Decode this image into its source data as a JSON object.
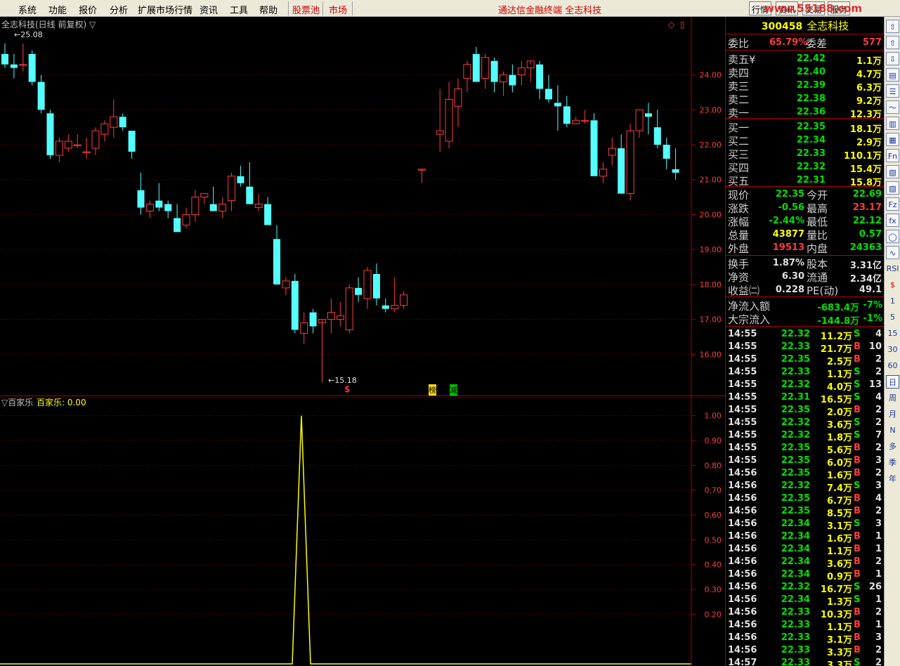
{
  "menubar": {
    "items": [
      "系统",
      "功能",
      "报价",
      "分析",
      "扩展市场行情",
      "资讯",
      "工具",
      "帮助"
    ],
    "pool": "股票池",
    "market": "市场",
    "center_title": "通达信金融终端  全志科技",
    "right_buttons": [
      "行情",
      "资讯",
      "交易",
      "服务"
    ],
    "watermark": "www.55188.com"
  },
  "chart": {
    "title": "全志科技(日线 前复权) ▽",
    "high_marker": "25.08",
    "low_marker": "15.18",
    "price_axis": [
      "24.00",
      "23.00",
      "22.00",
      "21.00",
      "20.00",
      "19.00",
      "18.00",
      "17.00",
      "16.00"
    ],
    "event_marks": [
      "$",
      "榜",
      "减"
    ],
    "indicator_title": "▽百家乐",
    "indicator_value": "百家乐: 0.00",
    "indicator_axis": [
      "1.00",
      "0.90",
      "0.80",
      "0.70",
      "0.60",
      "0.50",
      "0.40",
      "0.30",
      "0.20"
    ],
    "colors": {
      "up": "#ff3c3c",
      "down": "#54ffff",
      "indicator": "#ffff00",
      "grid": "#800000"
    }
  },
  "chart_data": {
    "type": "candlestick",
    "candles": [
      [
        24.6,
        24.9,
        24.2,
        24.3
      ],
      [
        24.3,
        24.6,
        23.9,
        24.2
      ],
      [
        24.3,
        24.9,
        24.1,
        24.3
      ],
      [
        24.6,
        24.7,
        23.7,
        23.8
      ],
      [
        23.8,
        24.0,
        22.9,
        23.0
      ],
      [
        22.9,
        23.0,
        21.6,
        21.7
      ],
      [
        21.7,
        22.2,
        21.5,
        22.1
      ],
      [
        21.9,
        22.3,
        21.8,
        22.1
      ],
      [
        22.0,
        22.3,
        21.9,
        22.0
      ],
      [
        21.8,
        22.2,
        21.6,
        21.8
      ],
      [
        21.9,
        22.5,
        21.7,
        22.4
      ],
      [
        22.3,
        22.7,
        22.1,
        22.6
      ],
      [
        22.5,
        23.3,
        22.2,
        22.8
      ],
      [
        22.8,
        22.9,
        22.4,
        22.5
      ],
      [
        22.4,
        22.4,
        21.6,
        21.8
      ],
      [
        20.7,
        21.2,
        20.0,
        20.2
      ],
      [
        20.1,
        20.4,
        19.9,
        20.3
      ],
      [
        20.4,
        20.9,
        20.1,
        20.2
      ],
      [
        20.3,
        20.4,
        19.9,
        20.1
      ],
      [
        19.9,
        20.3,
        19.5,
        19.5
      ],
      [
        19.7,
        20.2,
        19.6,
        20.0
      ],
      [
        20.0,
        20.7,
        19.8,
        20.5
      ],
      [
        20.5,
        20.6,
        20.3,
        20.6
      ],
      [
        20.3,
        20.8,
        20.1,
        20.1
      ],
      [
        20.1,
        20.5,
        19.9,
        20.3
      ],
      [
        20.4,
        21.2,
        20.1,
        21.1
      ],
      [
        21.1,
        21.4,
        20.8,
        20.9
      ],
      [
        20.8,
        21.5,
        20.4,
        20.3
      ],
      [
        20.2,
        20.6,
        20.1,
        20.3
      ],
      [
        20.3,
        20.5,
        19.7,
        19.7
      ],
      [
        19.3,
        19.7,
        18.0,
        18.0
      ],
      [
        17.9,
        18.2,
        17.7,
        18.1
      ],
      [
        18.1,
        18.3,
        16.6,
        16.7
      ],
      [
        16.6,
        17.2,
        16.3,
        16.9
      ],
      [
        17.2,
        17.3,
        16.6,
        16.8
      ],
      [
        16.9,
        16.9,
        15.2,
        17.0
      ],
      [
        17.0,
        17.6,
        16.6,
        17.2
      ],
      [
        17.0,
        17.5,
        16.8,
        17.1
      ],
      [
        16.7,
        18.0,
        16.6,
        17.9
      ],
      [
        17.9,
        18.2,
        17.5,
        17.7
      ],
      [
        17.6,
        18.5,
        17.3,
        18.4
      ],
      [
        18.3,
        18.6,
        17.4,
        17.6
      ],
      [
        17.4,
        17.6,
        17.2,
        17.3
      ],
      [
        17.3,
        18.2,
        17.2,
        17.4
      ],
      [
        17.4,
        17.8,
        17.3,
        17.7
      ],
      [
        null,
        null,
        null,
        null
      ],
      [
        21.3,
        21.3,
        20.9,
        21.3
      ],
      [
        null,
        null,
        null,
        null
      ],
      [
        22.3,
        23.6,
        21.8,
        22.4
      ],
      [
        22.1,
        23.8,
        21.9,
        23.3
      ],
      [
        23.1,
        23.9,
        22.5,
        23.6
      ],
      [
        23.9,
        24.4,
        23.5,
        24.3
      ],
      [
        24.6,
        24.8,
        23.8,
        23.8
      ],
      [
        23.9,
        24.6,
        23.6,
        24.5
      ],
      [
        24.4,
        24.5,
        23.5,
        23.8
      ],
      [
        23.8,
        24.1,
        23.4,
        24.0
      ],
      [
        24.0,
        24.3,
        23.5,
        23.7
      ],
      [
        24.0,
        24.4,
        23.7,
        24.2
      ],
      [
        24.2,
        24.3,
        23.8,
        24.4
      ],
      [
        24.3,
        24.4,
        23.3,
        23.6
      ],
      [
        23.6,
        24.0,
        23.2,
        23.3
      ],
      [
        23.2,
        23.7,
        22.4,
        23.1
      ],
      [
        23.1,
        23.4,
        22.5,
        22.6
      ],
      [
        22.6,
        22.8,
        22.6,
        22.7
      ],
      [
        22.7,
        23.0,
        22.6,
        22.7
      ],
      [
        22.7,
        22.9,
        21.1,
        21.1
      ],
      [
        21.1,
        21.5,
        20.9,
        21.3
      ],
      [
        21.7,
        22.2,
        21.4,
        21.9
      ],
      [
        21.9,
        22.3,
        20.6,
        20.6
      ],
      [
        20.6,
        22.6,
        20.4,
        22.4
      ],
      [
        22.4,
        23.0,
        22.2,
        23.0
      ],
      [
        22.9,
        23.2,
        22.3,
        22.8
      ],
      [
        22.5,
        23.0,
        21.9,
        22.0
      ],
      [
        22.0,
        22.2,
        21.3,
        21.6
      ],
      [
        21.3,
        21.9,
        21.0,
        21.2
      ]
    ],
    "price_range": [
      15.0,
      25.3
    ],
    "indicator": {
      "name": "百家乐",
      "peak_value": 1.0,
      "baseline": 0.0,
      "range": [
        0,
        1.05
      ]
    }
  },
  "panel": {
    "code": "300458",
    "name": "全志科技",
    "weibi": {
      "label": "委比",
      "value": "65.79%",
      "label2": "委差",
      "value2": "577"
    },
    "asks": [
      {
        "label": "卖五",
        "mark": "¥",
        "price": "22.42",
        "vol": "1.1万"
      },
      {
        "label": "卖四",
        "mark": "",
        "price": "22.40",
        "vol": "4.7万"
      },
      {
        "label": "卖三",
        "mark": "",
        "price": "22.39",
        "vol": "6.3万"
      },
      {
        "label": "卖二",
        "mark": "",
        "price": "22.38",
        "vol": "9.2万"
      },
      {
        "label": "卖一",
        "mark": "",
        "price": "22.36",
        "vol": "12.3万"
      }
    ],
    "bids": [
      {
        "label": "买一",
        "price": "22.35",
        "vol": "18.1万"
      },
      {
        "label": "买二",
        "price": "22.34",
        "vol": "2.9万"
      },
      {
        "label": "买三",
        "price": "22.33",
        "vol": "110.1万"
      },
      {
        "label": "买四",
        "price": "22.32",
        "vol": "15.4万"
      },
      {
        "label": "买五",
        "price": "22.31",
        "vol": "15.8万"
      }
    ],
    "stats1": [
      {
        "l1": "现价",
        "v1": "22.35",
        "c1": "green",
        "l2": "今开",
        "v2": "22.69",
        "c2": "green"
      },
      {
        "l1": "涨跌",
        "v1": "-0.56",
        "c1": "green",
        "l2": "最高",
        "v2": "23.17",
        "c2": "red"
      },
      {
        "l1": "涨幅",
        "v1": "-2.44%",
        "c1": "green",
        "l2": "最低",
        "v2": "22.12",
        "c2": "green"
      },
      {
        "l1": "总量",
        "v1": "43877",
        "c1": "yellow",
        "l2": "量比",
        "v2": "0.57",
        "c2": "green"
      },
      {
        "l1": "外盘",
        "v1": "19513",
        "c1": "red",
        "l2": "内盘",
        "v2": "24363",
        "c2": "green"
      }
    ],
    "stats2": [
      {
        "l1": "换手",
        "v1": "1.87%",
        "c1": "white",
        "l2": "股本",
        "v2": "3.31亿",
        "c2": "white"
      },
      {
        "l1": "净资",
        "v1": "6.30",
        "c1": "white",
        "l2": "流通",
        "v2": "2.34亿",
        "c2": "white"
      },
      {
        "l1": "收益㈡",
        "v1": "0.228",
        "c1": "white",
        "l2": "PE(动)",
        "v2": "49.1",
        "c2": "white"
      }
    ],
    "flows": [
      {
        "label": "净流入额",
        "value": "-683.4万",
        "pct": "-7%"
      },
      {
        "label": "大宗流入",
        "value": "-144.8万",
        "pct": "-1%"
      }
    ],
    "ticks": [
      [
        "14:55",
        "22.32",
        "11.2万",
        "S",
        "4"
      ],
      [
        "14:55",
        "22.33",
        "21.7万",
        "B",
        "10"
      ],
      [
        "14:55",
        "22.35",
        "2.5万",
        "B",
        "2"
      ],
      [
        "14:55",
        "22.33",
        "1.1万",
        "S",
        "2"
      ],
      [
        "14:55",
        "22.32",
        "4.0万",
        "S",
        "13"
      ],
      [
        "14:55",
        "22.31",
        "16.5万",
        "S",
        "4"
      ],
      [
        "14:55",
        "22.35",
        "2.0万",
        "B",
        "2"
      ],
      [
        "14:55",
        "22.32",
        "3.6万",
        "S",
        "2"
      ],
      [
        "14:55",
        "22.32",
        "1.8万",
        "S",
        "7"
      ],
      [
        "14:55",
        "22.35",
        "5.6万",
        "B",
        "2"
      ],
      [
        "14:55",
        "22.35",
        "6.0万",
        "B",
        "3"
      ],
      [
        "14:56",
        "22.35",
        "1.6万",
        "B",
        "2"
      ],
      [
        "14:56",
        "22.32",
        "7.4万",
        "S",
        "3"
      ],
      [
        "14:56",
        "22.35",
        "6.7万",
        "B",
        "4"
      ],
      [
        "14:56",
        "22.35",
        "8.5万",
        "B",
        "2"
      ],
      [
        "14:56",
        "22.34",
        "3.1万",
        "S",
        "3"
      ],
      [
        "14:56",
        "22.34",
        "1.6万",
        "B",
        "1"
      ],
      [
        "14:56",
        "22.34",
        "1.1万",
        "B",
        "1"
      ],
      [
        "14:56",
        "22.34",
        "3.6万",
        "B",
        "2"
      ],
      [
        "14:56",
        "22.34",
        "0.9万",
        "B",
        "1"
      ],
      [
        "14:56",
        "22.32",
        "16.7万",
        "S",
        "26"
      ],
      [
        "14:56",
        "22.34",
        "1.3万",
        "S",
        "1"
      ],
      [
        "14:56",
        "22.33",
        "10.3万",
        "B",
        "2"
      ],
      [
        "14:56",
        "22.33",
        "1.1万",
        "B",
        "1"
      ],
      [
        "14:56",
        "22.33",
        "3.1万",
        "B",
        "3"
      ],
      [
        "14:56",
        "22.33",
        "3.3万",
        "B",
        "2"
      ],
      [
        "14:57",
        "22.33",
        "3.3万",
        "S",
        "2"
      ]
    ]
  },
  "toolbar": {
    "items": [
      "up-icon",
      "up-icon",
      "down-icon",
      "report-icon",
      "list-icon",
      "line-chart-icon",
      "bar-chart-icon",
      "book-icon",
      "fin-icon",
      "doc-icon",
      "page-icon",
      "fiz-icon",
      "fx-icon",
      "circle-icon",
      "wave-icon"
    ],
    "text_items": [
      "RSI",
      "$",
      "1",
      "5",
      "15",
      "30",
      "60",
      "日",
      "周",
      "月",
      "N",
      "多",
      "季",
      "年"
    ]
  }
}
